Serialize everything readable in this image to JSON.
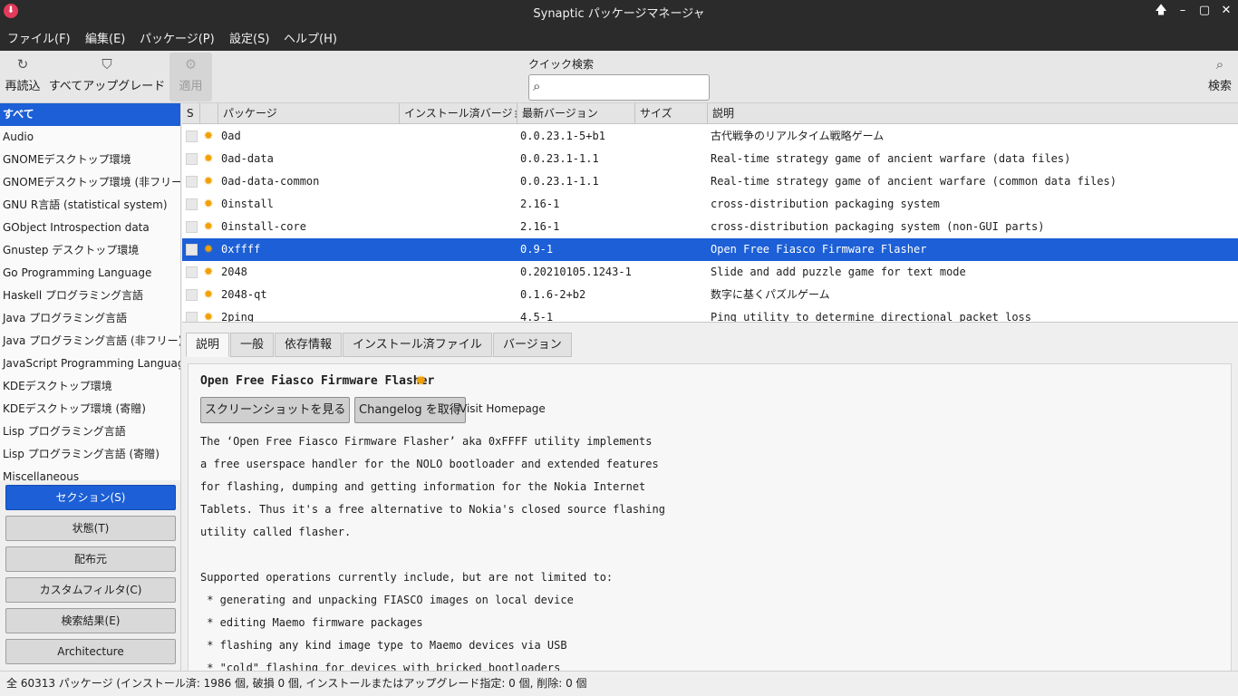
{
  "window": {
    "title": "Synaptic パッケージマネージャ",
    "controls": [
      "maximize-up-icon",
      "minimize-icon",
      "restore-icon",
      "close-icon"
    ]
  },
  "menubar": {
    "items": [
      "ファイル(F)",
      "編集(E)",
      "パッケージ(P)",
      "設定(S)",
      "ヘルプ(H)"
    ]
  },
  "toolbar": {
    "reload_label": "再読込",
    "upgrade_all_label": "すべてアップグレード",
    "apply_label": "適用",
    "quick_search_label": "クイック検索",
    "quick_search_value": "",
    "search_label": "検索"
  },
  "sidebar": {
    "sections": [
      "すべて",
      "Audio",
      "GNOMEデスクトップ環境",
      "GNOMEデスクトップ環境 (非フリー)",
      "GNU R言語 (statistical system)",
      "GObject Introspection data",
      "Gnustep デスクトップ環境",
      "Go Programming Language",
      "Haskell プログラミング言語",
      "Java プログラミング言語",
      "Java プログラミング言語 (非フリー)",
      "JavaScript Programming Language",
      "KDEデスクトップ環境",
      "KDEデスクトップ環境 (寄贈)",
      "Lisp プログラミング言語",
      "Lisp プログラミング言語 (寄贈)",
      "Miscellaneous"
    ],
    "selected_index": 0,
    "filter_buttons": [
      "セクション(S)",
      "状態(T)",
      "配布元",
      "カスタムフィルタ(C)",
      "検索結果(E)",
      "Architecture"
    ],
    "active_filter_index": 0
  },
  "package_table": {
    "columns": [
      "S",
      "",
      "パッケージ",
      "インストール済バージョン",
      "最新バージョン",
      "サイズ",
      "説明"
    ],
    "rows": [
      {
        "name": "0ad",
        "installed": "",
        "latest": "0.0.23.1-5+b1",
        "size": "",
        "desc": "古代戦争のリアルタイム戦略ゲーム",
        "selected": false
      },
      {
        "name": "0ad-data",
        "installed": "",
        "latest": "0.0.23.1-1.1",
        "size": "",
        "desc": "Real-time strategy game of ancient warfare (data files)",
        "selected": false
      },
      {
        "name": "0ad-data-common",
        "installed": "",
        "latest": "0.0.23.1-1.1",
        "size": "",
        "desc": "Real-time strategy game of ancient warfare (common data files)",
        "selected": false
      },
      {
        "name": "0install",
        "installed": "",
        "latest": "2.16-1",
        "size": "",
        "desc": "cross-distribution packaging system",
        "selected": false
      },
      {
        "name": "0install-core",
        "installed": "",
        "latest": "2.16-1",
        "size": "",
        "desc": "cross-distribution packaging system (non-GUI parts)",
        "selected": false
      },
      {
        "name": "0xffff",
        "installed": "",
        "latest": "0.9-1",
        "size": "",
        "desc": "Open Free Fiasco Firmware Flasher",
        "selected": true
      },
      {
        "name": "2048",
        "installed": "",
        "latest": "0.20210105.1243-1",
        "size": "",
        "desc": "Slide and add puzzle game for text mode",
        "selected": false
      },
      {
        "name": "2048-qt",
        "installed": "",
        "latest": "0.1.6-2+b2",
        "size": "",
        "desc": "数字に基くパズルゲーム",
        "selected": false
      },
      {
        "name": "2ping",
        "installed": "",
        "latest": "4.5-1",
        "size": "",
        "desc": "Ping utility to determine directional packet loss",
        "selected": false
      }
    ]
  },
  "details": {
    "tabs": [
      "説明",
      "一般",
      "依存情報",
      "インストール済ファイル",
      "バージョン"
    ],
    "active_tab_index": 0,
    "title": "Open Free Fiasco Firmware Flasher",
    "screenshot_button": "スクリーンショットを見る",
    "changelog_button": "Changelog を取得",
    "homepage_link": "Visit Homepage",
    "description_lines": [
      "The ‘Open Free Fiasco Firmware Flasher’ aka 0xFFFF utility implements",
      "a free userspace handler for the NOLO bootloader and extended features",
      "for flashing, dumping and getting information for the Nokia Internet",
      "Tablets. Thus it's a free alternative to Nokia's closed source flashing",
      "utility called flasher.",
      "",
      "Supported operations currently include, but are not limited to:",
      " * generating and unpacking FIASCO images on local device",
      " * editing Maemo firmware packages",
      " * flashing any kind image type to Maemo devices via USB",
      " * \"cold\" flashing for devices with bricked bootloaders"
    ]
  },
  "statusbar": {
    "text": "全 60313 パッケージ (インストール済: 1986 個, 破損 0 個, インストールまたはアップグレード指定: 0 個, 削除: 0 個"
  },
  "colors": {
    "selection": "#1c5fd6",
    "titlebar": "#2b2b2b",
    "status_icon": "#f2a000"
  }
}
